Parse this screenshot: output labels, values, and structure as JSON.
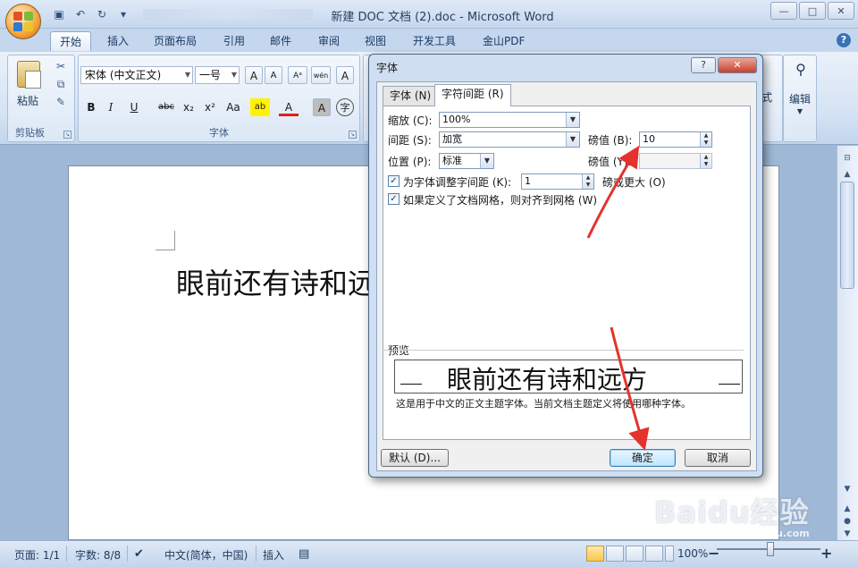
{
  "window": {
    "title": "新建 DOC 文档 (2).doc - Microsoft Word",
    "min_glyph": "—",
    "max_glyph": "□",
    "close_glyph": "✕"
  },
  "qat": {
    "save_glyph": "▣",
    "undo_glyph": "↶",
    "redo_glyph": "↻",
    "more_glyph": "▾"
  },
  "tabs": [
    {
      "label": "开始",
      "active": true
    },
    {
      "label": "插入"
    },
    {
      "label": "页面布局"
    },
    {
      "label": "引用"
    },
    {
      "label": "邮件"
    },
    {
      "label": "审阅"
    },
    {
      "label": "视图"
    },
    {
      "label": "开发工具"
    },
    {
      "label": "金山PDF"
    }
  ],
  "ribbon": {
    "clipboard": {
      "paste_label": "粘贴",
      "group_label": "剪贴板"
    },
    "font": {
      "font_name": "宋体 (中文正文)",
      "font_size": "一号",
      "grow_glyph": "A",
      "shrink_glyph": "A",
      "bold": "B",
      "italic": "I",
      "underline": "U",
      "strike": "abc",
      "subscript": "x₂",
      "superscript": "x²",
      "case": "Aa",
      "highlight": "ab",
      "font_color": "A",
      "char_shading": "A",
      "enclose": "字",
      "clear_glyph": "Aᵃ",
      "phonetic": "wén",
      "border_char": "A",
      "group_label": "字体"
    },
    "editing": {
      "label": "编辑",
      "find_glyph": "🔭"
    },
    "styles_partial": "式"
  },
  "document": {
    "text": "眼前还有诗和远方"
  },
  "dialog": {
    "title": "字体",
    "help_label": "?",
    "close_label": "✕",
    "tabs": [
      {
        "label": "字体 (N)"
      },
      {
        "label": "字符间距 (R)",
        "active": true
      }
    ],
    "scale": {
      "label": "缩放 (C):",
      "value": "100%"
    },
    "spacing": {
      "label": "间距 (S):",
      "value": "加宽",
      "by_label": "磅值 (B):",
      "by_value": "10"
    },
    "position": {
      "label": "位置 (P):",
      "value": "标准",
      "by_label": "磅值 (Y):",
      "by_value": ""
    },
    "kerning": {
      "label": "为字体调整字间距 (K):",
      "value": "1",
      "suffix": "磅或更大 (O)",
      "checked": true
    },
    "grid": {
      "label": "如果定义了文档网格，则对齐到网格 (W)",
      "checked": true
    },
    "preview": {
      "label": "预览",
      "text": "眼前还有诗和远方",
      "caption": "这是用于中文的正文主题字体。当前文档主题定义将使用哪种字体。"
    },
    "buttons": {
      "default": "默认 (D)...",
      "ok": "确定",
      "cancel": "取消"
    }
  },
  "statusbar": {
    "page": "页面: 1/1",
    "words": "字数: 8/8",
    "language": "中文(简体，中国)",
    "insert": "插入",
    "zoom": "100%",
    "zoom_minus": "−",
    "zoom_plus": "+"
  },
  "watermark": {
    "main": "Baidu经验",
    "sub": "jingyan.baidu.com"
  },
  "colors": {
    "accent": "#c5d7ee",
    "arrow": "#e5322d",
    "ok_button": "#bee6fd"
  }
}
